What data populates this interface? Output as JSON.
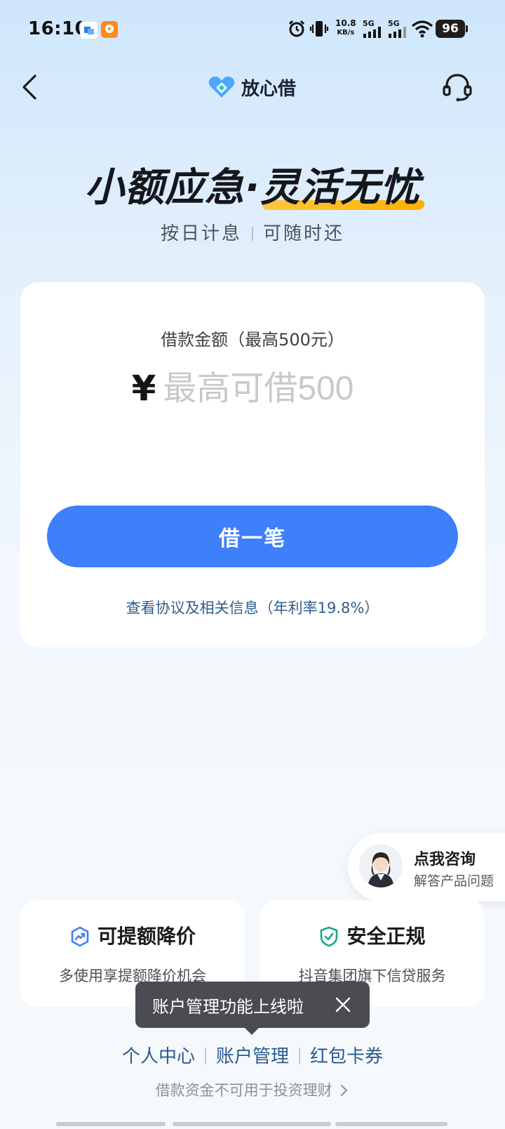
{
  "status_bar": {
    "time": "16:10",
    "net_speed_value": "10.8",
    "net_speed_unit": "KB/s",
    "sim1_label": "5G",
    "sim2_label": "5G",
    "battery": "96"
  },
  "nav": {
    "brand": "放心借"
  },
  "hero": {
    "title_part1": "小额应急·",
    "title_part2": "灵活无忧",
    "sub_left": "按日计息",
    "sub_right": "可随时还"
  },
  "loan_card": {
    "amount_label": "借款金额（最高500元）",
    "currency": "¥",
    "amount_placeholder": "最高可借500",
    "borrow_button": "借一笔",
    "agreement_link": "查看协议及相关信息（年利率19.8%）"
  },
  "consult": {
    "title": "点我咨询",
    "subtitle": "解答产品问题"
  },
  "features": [
    {
      "title": "可提额降价",
      "desc": "多使用享提额降价机会"
    },
    {
      "title": "安全正规",
      "desc": "抖音集团旗下信贷服务"
    }
  ],
  "toast": {
    "text": "账户管理功能上线啦"
  },
  "footer": {
    "links": [
      "个人中心",
      "账户管理",
      "红包卡券"
    ],
    "note": "借款资金不可用于投资理财"
  },
  "colors": {
    "accent": "#3e7ffa",
    "link": "#2a5b8f",
    "highlight": "#ffb100"
  }
}
